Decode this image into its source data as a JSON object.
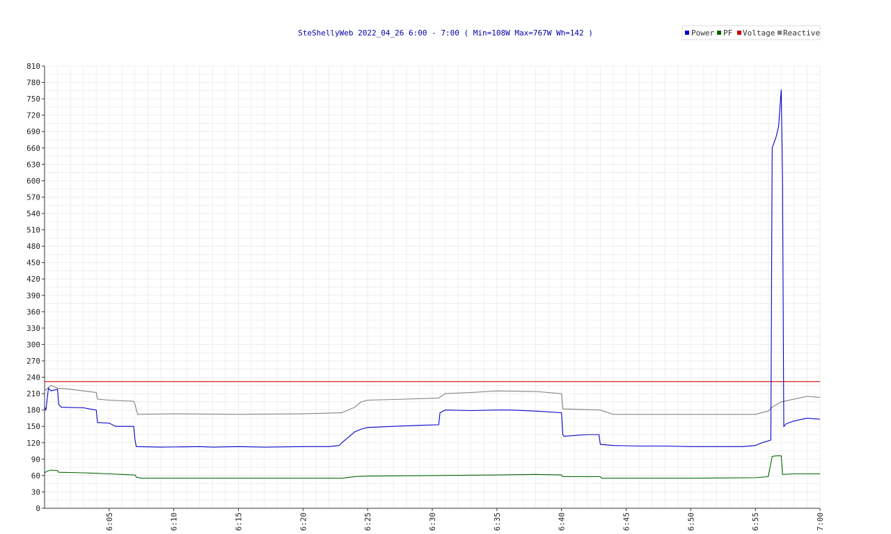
{
  "chart_data": {
    "type": "line",
    "title": "SteShellyWeb 2022_04_26 6:00 - 7:00 ( Min=108W Max=767W  Wh=142 )",
    "xlabel": "",
    "ylabel": "",
    "xlim": [
      0,
      60
    ],
    "ylim": [
      0,
      810
    ],
    "y_ticks": [
      0,
      30,
      60,
      90,
      120,
      150,
      180,
      210,
      240,
      270,
      300,
      330,
      360,
      390,
      420,
      450,
      480,
      510,
      540,
      570,
      600,
      630,
      660,
      690,
      720,
      750,
      780,
      810
    ],
    "x_ticks": [
      {
        "v": 5,
        "label": "6:05"
      },
      {
        "v": 10,
        "label": "6:10"
      },
      {
        "v": 15,
        "label": "6:15"
      },
      {
        "v": 20,
        "label": "6:20"
      },
      {
        "v": 25,
        "label": "6:25"
      },
      {
        "v": 30,
        "label": "6:30"
      },
      {
        "v": 35,
        "label": "6:35"
      },
      {
        "v": 40,
        "label": "6:40"
      },
      {
        "v": 45,
        "label": "6:45"
      },
      {
        "v": 50,
        "label": "6:50"
      },
      {
        "v": 55,
        "label": "6:55"
      },
      {
        "v": 60,
        "label": "7:00"
      }
    ],
    "grid": true,
    "legend_position": "top-right",
    "series": [
      {
        "name": "Power",
        "color": "#0000cc",
        "x": [
          0,
          0.1,
          0.3,
          0.5,
          1.0,
          1.1,
          1.3,
          3.0,
          4.0,
          4.1,
          5.0,
          5.5,
          6.9,
          7.0,
          7.1,
          9,
          12,
          13,
          15,
          17,
          20,
          22,
          22.8,
          23,
          23.5,
          24,
          24.5,
          25,
          27,
          29,
          30.5,
          30.6,
          31,
          33,
          35,
          36,
          38,
          40,
          40.1,
          40.2,
          42,
          42.9,
          43,
          44,
          46,
          48,
          50,
          52,
          54,
          55,
          55.5,
          56.2,
          56.3,
          56.6,
          56.8,
          57.0,
          57.1,
          57.2,
          57.4,
          58,
          59,
          60
        ],
        "y": [
          185,
          180,
          220,
          215,
          218,
          190,
          185,
          184,
          180,
          157,
          156,
          150,
          150,
          125,
          113,
          112,
          113,
          112,
          113,
          112,
          113,
          113,
          115,
          120,
          130,
          140,
          145,
          148,
          150,
          152,
          153,
          175,
          180,
          179,
          180,
          180,
          178,
          175,
          135,
          132,
          135,
          135,
          117,
          115,
          114,
          114,
          113,
          113,
          113,
          115,
          120,
          125,
          660,
          680,
          700,
          767,
          600,
          150,
          155,
          160,
          165,
          163
        ]
      },
      {
        "name": "PF",
        "color": "#006600",
        "x": [
          0,
          0.2,
          0.5,
          1.0,
          1.1,
          3,
          4,
          5,
          6,
          7,
          7.1,
          7.5,
          12,
          20,
          23,
          24,
          25,
          30,
          35,
          38,
          40,
          40.1,
          43,
          43.1,
          50,
          55,
          56,
          56.3,
          56.6,
          57.0,
          57.1,
          58,
          60
        ],
        "y": [
          65,
          68,
          70,
          69,
          66,
          65,
          64,
          63,
          62,
          61,
          57,
          55,
          55,
          55,
          55,
          58,
          59,
          60,
          61,
          62,
          61,
          58,
          58,
          55,
          55,
          56,
          58,
          95,
          96,
          96,
          62,
          63,
          63
        ]
      },
      {
        "name": "Voltage",
        "color": "#cc0000",
        "x": [
          0,
          60
        ],
        "y": [
          232,
          232
        ]
      },
      {
        "name": "Reactive",
        "color": "#808080",
        "x": [
          0,
          0.5,
          1,
          2,
          3,
          4,
          4.1,
          5,
          6.9,
          7.0,
          7.2,
          10,
          15,
          20,
          23,
          24,
          24.5,
          25,
          28,
          30.5,
          31,
          33,
          35,
          38,
          40,
          40.1,
          43,
          44,
          46,
          50,
          54,
          55,
          56,
          56.3,
          57,
          58,
          59,
          60
        ],
        "y": [
          215,
          225,
          220,
          218,
          215,
          212,
          200,
          198,
          196,
          190,
          172,
          173,
          172,
          173,
          175,
          185,
          195,
          198,
          200,
          202,
          210,
          212,
          215,
          214,
          210,
          182,
          180,
          172,
          172,
          172,
          172,
          172,
          178,
          185,
          195,
          200,
          205,
          203
        ]
      }
    ]
  }
}
